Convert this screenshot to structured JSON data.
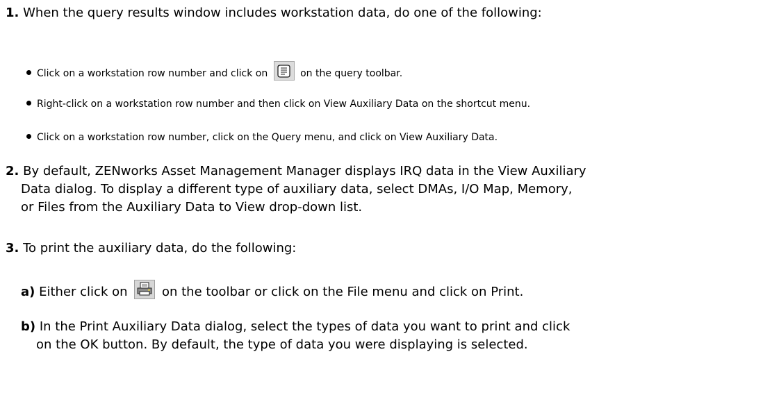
{
  "step1": {
    "number": "1.",
    "text": "When the query results window includes workstation data, do one of the following:",
    "bullets": [
      {
        "before": "Click on a workstation row number and click on",
        "icon": "view-auxiliary-data-icon",
        "after": "on the query toolbar."
      },
      {
        "text": "Right-click on a workstation row number and then click on View Auxiliary Data on the shortcut menu."
      },
      {
        "text": "Click on a workstation row number, click on the Query menu, and click on View Auxiliary Data."
      }
    ]
  },
  "step2": {
    "number": "2.",
    "line1": "By default, ZENworks Asset Management Manager displays IRQ data in the View Auxiliary",
    "line2": "Data dialog. To display a different type of auxiliary data, select DMAs, I/O Map, Memory,",
    "line3": "or Files from the Auxiliary Data to View drop-down list."
  },
  "step3": {
    "number": "3.",
    "text": "To print the auxiliary data, do the following:",
    "substeps": [
      {
        "label": "a)",
        "before": "Either click on",
        "icon": "printer-icon",
        "after": "on the toolbar or click on the File menu and click on Print."
      },
      {
        "label": "b)",
        "line1": "In the Print Auxiliary Data dialog, select the types of data you want to print and click",
        "line2": "on the OK button. By default, the type of data you were displaying is selected."
      }
    ]
  }
}
